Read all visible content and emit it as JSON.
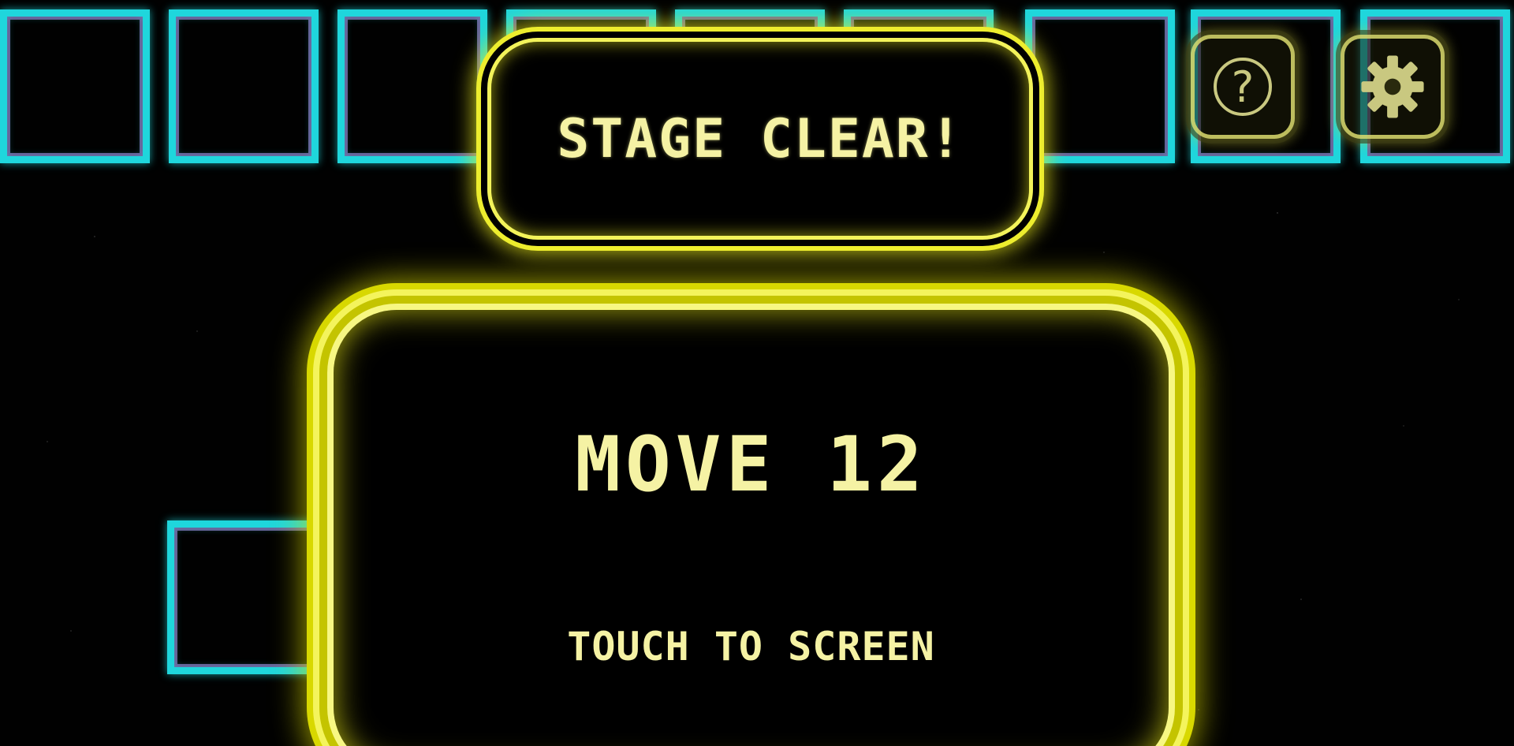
{
  "game": {
    "stage_clear_title": "STAGE CLEAR!",
    "move_label": "MOVE 12",
    "touch_prompt": "TOUCH TO SCREEN"
  },
  "buttons": {
    "help": {
      "icon": "help-icon",
      "glyph": "?"
    },
    "settings": {
      "icon": "gear-icon"
    }
  },
  "colors": {
    "background": "#000000",
    "tile_cyan": "#1fd6dc",
    "tile_outline_purple": "#b4a0ff",
    "panel_yellow": "#eded2e",
    "text_yellow": "#f5f2a4",
    "button_tint": "#c9c880"
  }
}
